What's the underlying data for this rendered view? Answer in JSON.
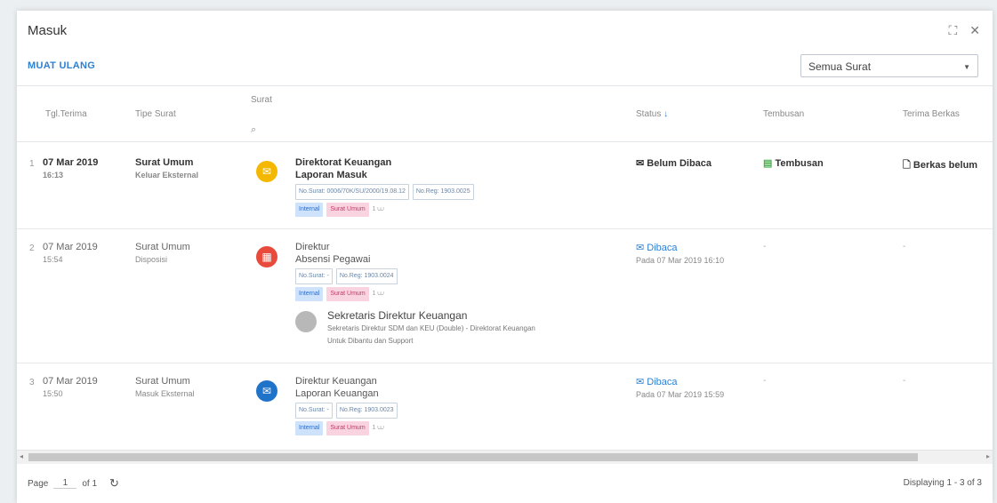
{
  "window": {
    "title": "Masuk",
    "expand_icon": "expand-icon",
    "close_icon": "close-icon"
  },
  "toolbar": {
    "reload_label": "MUAT ULANG",
    "filter_value": "Semua Surat"
  },
  "columns": {
    "tgl_terima": "Tgl.Terima",
    "tipe_surat": "Tipe Surat",
    "surat": "Surat",
    "status": "Status",
    "status_sort": "↓",
    "tembusan": "Tembusan",
    "terima_berkas": "Terima Berkas"
  },
  "rows": [
    {
      "no": "1",
      "date": "07 Mar 2019",
      "time": "16:13",
      "type": "Surat Umum",
      "subtype": "Keluar Eksternal",
      "from": "Direktorat Keuangan",
      "subject": "Laporan Masuk",
      "no_surat": "No.Surat: 0006/70K/SU/2000/19.08.12",
      "no_reg": "No.Reg: 1903.0025",
      "tag1": "Internal",
      "tag2": "Surat Umum",
      "attach": "1 ⩊",
      "status": "Belum Dibaca",
      "status_date": "",
      "tembusan": "Tembusan",
      "berkas": "Berkas belum"
    },
    {
      "no": "2",
      "date": "07 Mar 2019",
      "time": "15:54",
      "type": "Surat Umum",
      "subtype": "Disposisi",
      "from": "Direktur",
      "subject": "Absensi Pegawai",
      "no_surat": "No.Surat: -",
      "no_reg": "No.Reg: 1903.0024",
      "tag1": "Internal",
      "tag2": "Surat Umum",
      "attach": "1 ⩊",
      "status": "Dibaca",
      "status_date": "Pada 07 Mar 2019 16:10",
      "tembusan": "-",
      "berkas": "-",
      "disposisi": {
        "name": "Sekretaris Direktur Keuangan",
        "detail": "Sekretaris Direktur SDM dan KEU (Double) - Direktorat Keuangan",
        "note": "Untuk Dibantu dan Support"
      }
    },
    {
      "no": "3",
      "date": "07 Mar 2019",
      "time": "15:50",
      "type": "Surat Umum",
      "subtype": "Masuk Eksternal",
      "from": "Direktur Keuangan",
      "subject": "Laporan Keuangan",
      "no_surat": "No.Surat: -",
      "no_reg": "No.Reg: 1903.0023",
      "tag1": "Internal",
      "tag2": "Surat Umum",
      "attach": "1 ⩊",
      "status": "Dibaca",
      "status_date": "Pada 07 Mar 2019 15:59",
      "tembusan": "-",
      "berkas": "-"
    }
  ],
  "pagination": {
    "page_label": "Page",
    "page": "1",
    "of_label": "of 1",
    "refresh_icon": "refresh-icon",
    "display_text": "Displaying 1 - 3 of 3"
  },
  "colors": {
    "accent": "#2f80d1",
    "row1_icon": "#f5b800",
    "row2_icon": "#e84b3c",
    "row3_icon": "#1f73c9",
    "tag_internal": "#cfe2fb",
    "tag_surat": "#f9d3df"
  }
}
